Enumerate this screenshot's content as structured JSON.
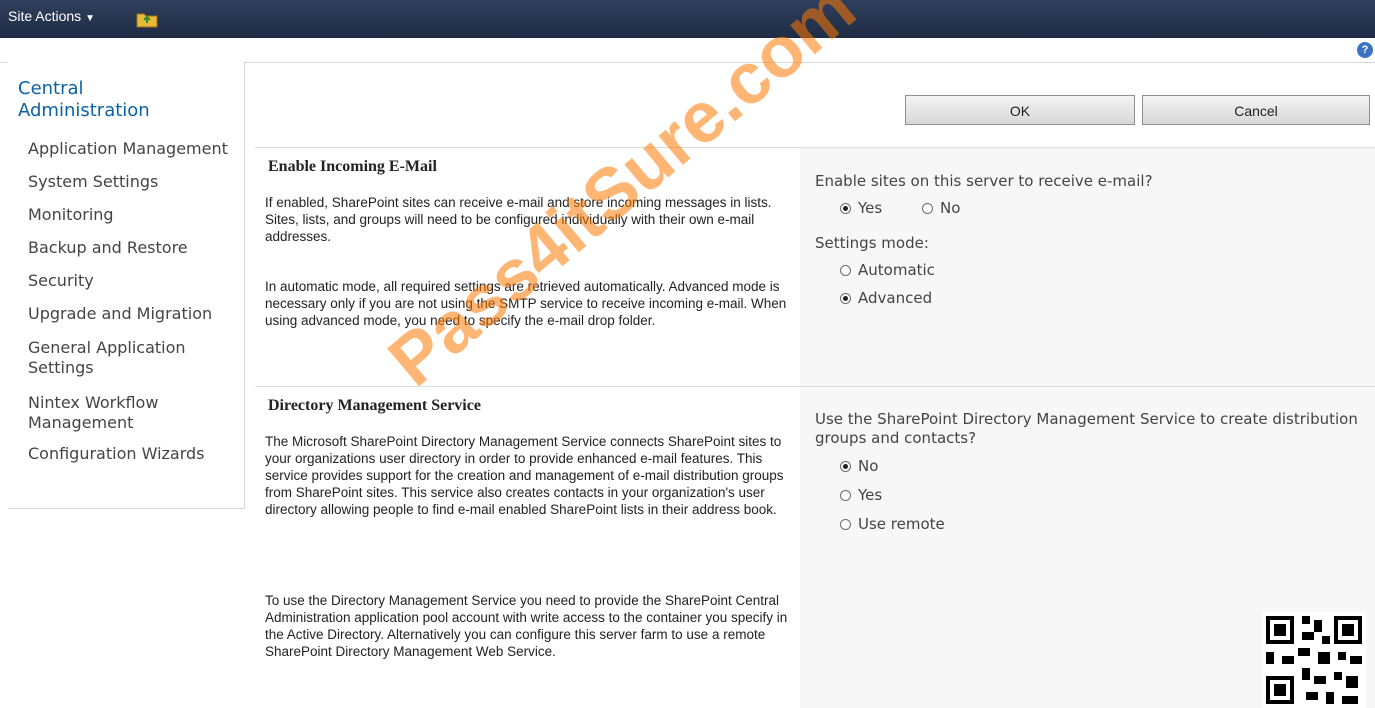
{
  "ribbon": {
    "site_actions_label": "Site Actions",
    "site_actions_arrow": "▼"
  },
  "help": {
    "icon": "?"
  },
  "quick_launch": {
    "title": "Central Administration",
    "items": [
      "Application Management",
      "System Settings",
      "Monitoring",
      "Backup and Restore",
      "Security",
      "Upgrade and Migration",
      "General Application Settings",
      "Nintex Workflow Management",
      "Configuration Wizards"
    ]
  },
  "buttons": {
    "ok": "OK",
    "cancel": "Cancel"
  },
  "incoming_email": {
    "title": "Enable Incoming E-Mail",
    "desc1": "If enabled, SharePoint sites can receive e-mail and store incoming messages in lists. Sites, lists, and groups will need to be configured individually with their own e-mail addresses.",
    "desc2": "In automatic mode, all required settings are retrieved automatically. Advanced mode is necessary only if you are not using the SMTP service to receive incoming e-mail. When using advanced mode, you need to specify the e-mail drop folder.",
    "question": "Enable sites on this server to receive e-mail?",
    "options": [
      "Yes",
      "No"
    ],
    "selected": "Yes",
    "mode_label": "Settings mode:",
    "mode_options": [
      "Automatic",
      "Advanced"
    ],
    "mode_selected": "Advanced"
  },
  "directory_management": {
    "title": "Directory Management Service",
    "desc1": "The Microsoft SharePoint Directory Management Service connects SharePoint sites to your organizations user directory in order to provide enhanced e-mail features. This service provides support for the creation and management of e-mail distribution groups from SharePoint sites. This service also creates contacts in your organization's user directory allowing people to find e-mail enabled SharePoint lists in their address book.",
    "desc2": "To use the Directory Management Service you need to provide the SharePoint Central Administration application pool account with write access to the container you specify in the Active Directory. Alternatively you can configure this server farm to use a remote SharePoint Directory Management Web Service.",
    "question": "Use the SharePoint Directory Management Service to create distribution groups and contacts?",
    "options": [
      "No",
      "Yes",
      "Use remote"
    ],
    "selected": "No"
  },
  "watermark": "Pass4itSure.com",
  "colors": {
    "ribbon": "#1f2c44",
    "link": "#0b62a5",
    "panel": "#f7f7f7"
  }
}
